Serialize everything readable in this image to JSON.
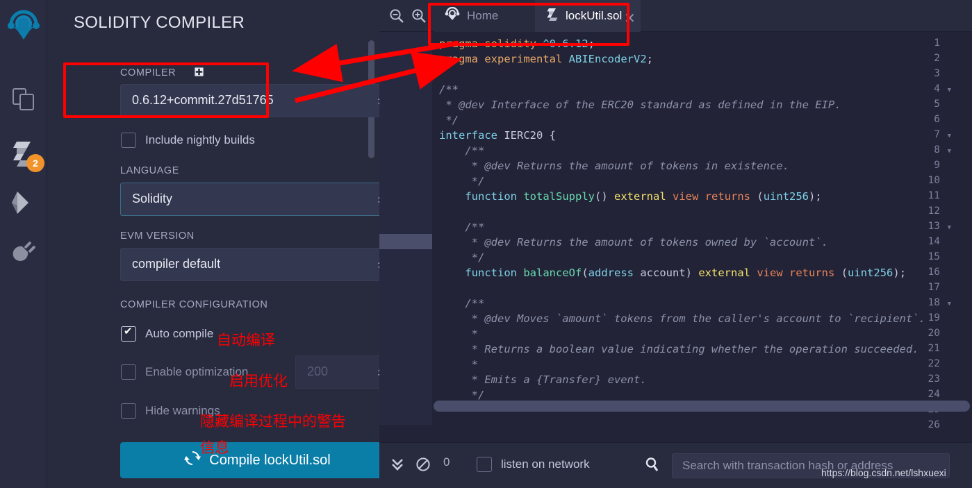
{
  "app": {
    "name": "Remix IDE",
    "watermark": "https://blog.csdn.net/lshxuexi"
  },
  "rail": {
    "items": [
      {
        "name": "remix-logo-icon",
        "label": "Remix"
      },
      {
        "name": "file-explorers-icon",
        "label": "File explorers"
      },
      {
        "name": "solidity-compiler-icon",
        "label": "Solidity compiler",
        "badge": "2"
      },
      {
        "name": "deploy-run-icon",
        "label": "Deploy & run transactions"
      },
      {
        "name": "plugin-manager-icon",
        "label": "Plugin manager"
      }
    ]
  },
  "panel": {
    "title": "SOLIDITY COMPILER",
    "book_icon": "documentation-icon",
    "compiler": {
      "label": "COMPILER",
      "plus_icon": "add-custom-compiler-icon",
      "value": "0.6.12+commit.27d51765"
    },
    "nightly": {
      "label": "Include nightly builds",
      "checked": false
    },
    "language": {
      "label": "LANGUAGE",
      "value": "Solidity"
    },
    "evm": {
      "label": "EVM VERSION",
      "value": "compiler default"
    },
    "config": {
      "label": "COMPILER CONFIGURATION",
      "auto_compile": {
        "label": "Auto compile",
        "checked": true
      },
      "enable_optimization": {
        "label": "Enable optimization",
        "checked": false,
        "runs": "200"
      },
      "hide_warnings": {
        "label": "Hide warnings",
        "checked": false
      }
    },
    "compile_button": {
      "label": "Compile lockUtil.sol",
      "icon": "refresh-icon",
      "color": "#0b7ea8"
    }
  },
  "editor": {
    "zoom_out_icon": "zoom-out-icon",
    "zoom_in_icon": "zoom-in-icon",
    "tabs": [
      {
        "label": "Home",
        "icon": "remix-home-icon",
        "active": false
      },
      {
        "label": "lockUtil.sol",
        "icon": "solidity-file-icon",
        "active": true,
        "close": "✕"
      }
    ],
    "active_line": 14,
    "lines": [
      {
        "n": "1",
        "fold": false,
        "html": "<span class=\"kw\">pragma</span> <span class=\"kw\">solidity</span> <span class=\"num\">^0.6.12</span><span class=\"pl\">;</span>"
      },
      {
        "n": "2",
        "fold": false,
        "html": "<span class=\"kw\">pragma</span> <span class=\"kw\">experimental</span> <span class=\"ty\">ABIEncoderV2</span><span class=\"pl\">;</span>"
      },
      {
        "n": "3",
        "fold": false,
        "html": ""
      },
      {
        "n": "4",
        "fold": true,
        "html": "<span class=\"cm\">/**</span>"
      },
      {
        "n": "5",
        "fold": false,
        "html": "<span class=\"cm\"> * @dev Interface of the ERC20 standard as defined in the EIP.</span>"
      },
      {
        "n": "6",
        "fold": false,
        "html": "<span class=\"cm\"> */</span>"
      },
      {
        "n": "7",
        "fold": true,
        "html": "<span class=\"k\">interface</span> <span class=\"pl\">IERC20 {</span>"
      },
      {
        "n": "8",
        "fold": true,
        "html": "<span class=\"cm\">    /**</span>"
      },
      {
        "n": "9",
        "fold": false,
        "html": "<span class=\"cm\">     * @dev Returns the amount of tokens in existence.</span>"
      },
      {
        "n": "10",
        "fold": false,
        "html": "<span class=\"cm\">     */</span>"
      },
      {
        "n": "11",
        "fold": false,
        "html": "    <span class=\"k\">function</span> <span class=\"fn\">totalSupply</span><span class=\"pl\">()</span> <span class=\"mod\">external</span> <span class=\"ret\">view</span> <span class=\"ret\">returns</span> <span class=\"pl\">(</span><span class=\"ty\">uint256</span><span class=\"pl\">);</span>"
      },
      {
        "n": "12",
        "fold": false,
        "html": ""
      },
      {
        "n": "13",
        "fold": true,
        "html": "<span class=\"cm\">    /**</span>"
      },
      {
        "n": "14",
        "fold": false,
        "html": "<span class=\"cm\">     * @dev Returns the amount of tokens owned by `account`.</span>"
      },
      {
        "n": "15",
        "fold": false,
        "html": "<span class=\"cm\">     */</span>"
      },
      {
        "n": "16",
        "fold": false,
        "html": "    <span class=\"k\">function</span> <span class=\"fn\">balanceOf</span><span class=\"pl\">(</span><span class=\"ty\">address</span> <span class=\"pl\">account)</span> <span class=\"mod\">external</span> <span class=\"ret\">view</span> <span class=\"ret\">returns</span> <span class=\"pl\">(</span><span class=\"ty\">uint256</span><span class=\"pl\">);</span>"
      },
      {
        "n": "17",
        "fold": false,
        "html": ""
      },
      {
        "n": "18",
        "fold": true,
        "html": "<span class=\"cm\">    /**</span>"
      },
      {
        "n": "19",
        "fold": false,
        "html": "<span class=\"cm\">     * @dev Moves `amount` tokens from the caller's account to `recipient`.</span>"
      },
      {
        "n": "20",
        "fold": false,
        "html": "<span class=\"cm\">     *</span>"
      },
      {
        "n": "21",
        "fold": false,
        "html": "<span class=\"cm\">     * Returns a boolean value indicating whether the operation succeeded.</span>"
      },
      {
        "n": "22",
        "fold": false,
        "html": "<span class=\"cm\">     *</span>"
      },
      {
        "n": "23",
        "fold": false,
        "html": "<span class=\"cm\">     * Emits a {Transfer} event.</span>"
      },
      {
        "n": "24",
        "fold": false,
        "html": "<span class=\"cm\">     */</span>"
      },
      {
        "n": "25",
        "fold": false,
        "html": ""
      },
      {
        "n": "26",
        "fold": false,
        "html": ""
      }
    ]
  },
  "terminal": {
    "collapse_icon": "chevron-double-down-icon",
    "clear_icon": "ban-icon",
    "count": "0",
    "listen": {
      "label": "listen on network",
      "checked": false
    },
    "search_icon": "search-icon",
    "search_placeholder": "Search with transaction hash or address"
  },
  "annotations": {
    "auto_compile_cn": "自动编译",
    "enable_optimization_cn": "启用优化",
    "hide_warnings_cn_1": "隐藏编译过程中的警告",
    "hide_warnings_cn_2": "信息",
    "highlight_color": "#fe0000"
  }
}
